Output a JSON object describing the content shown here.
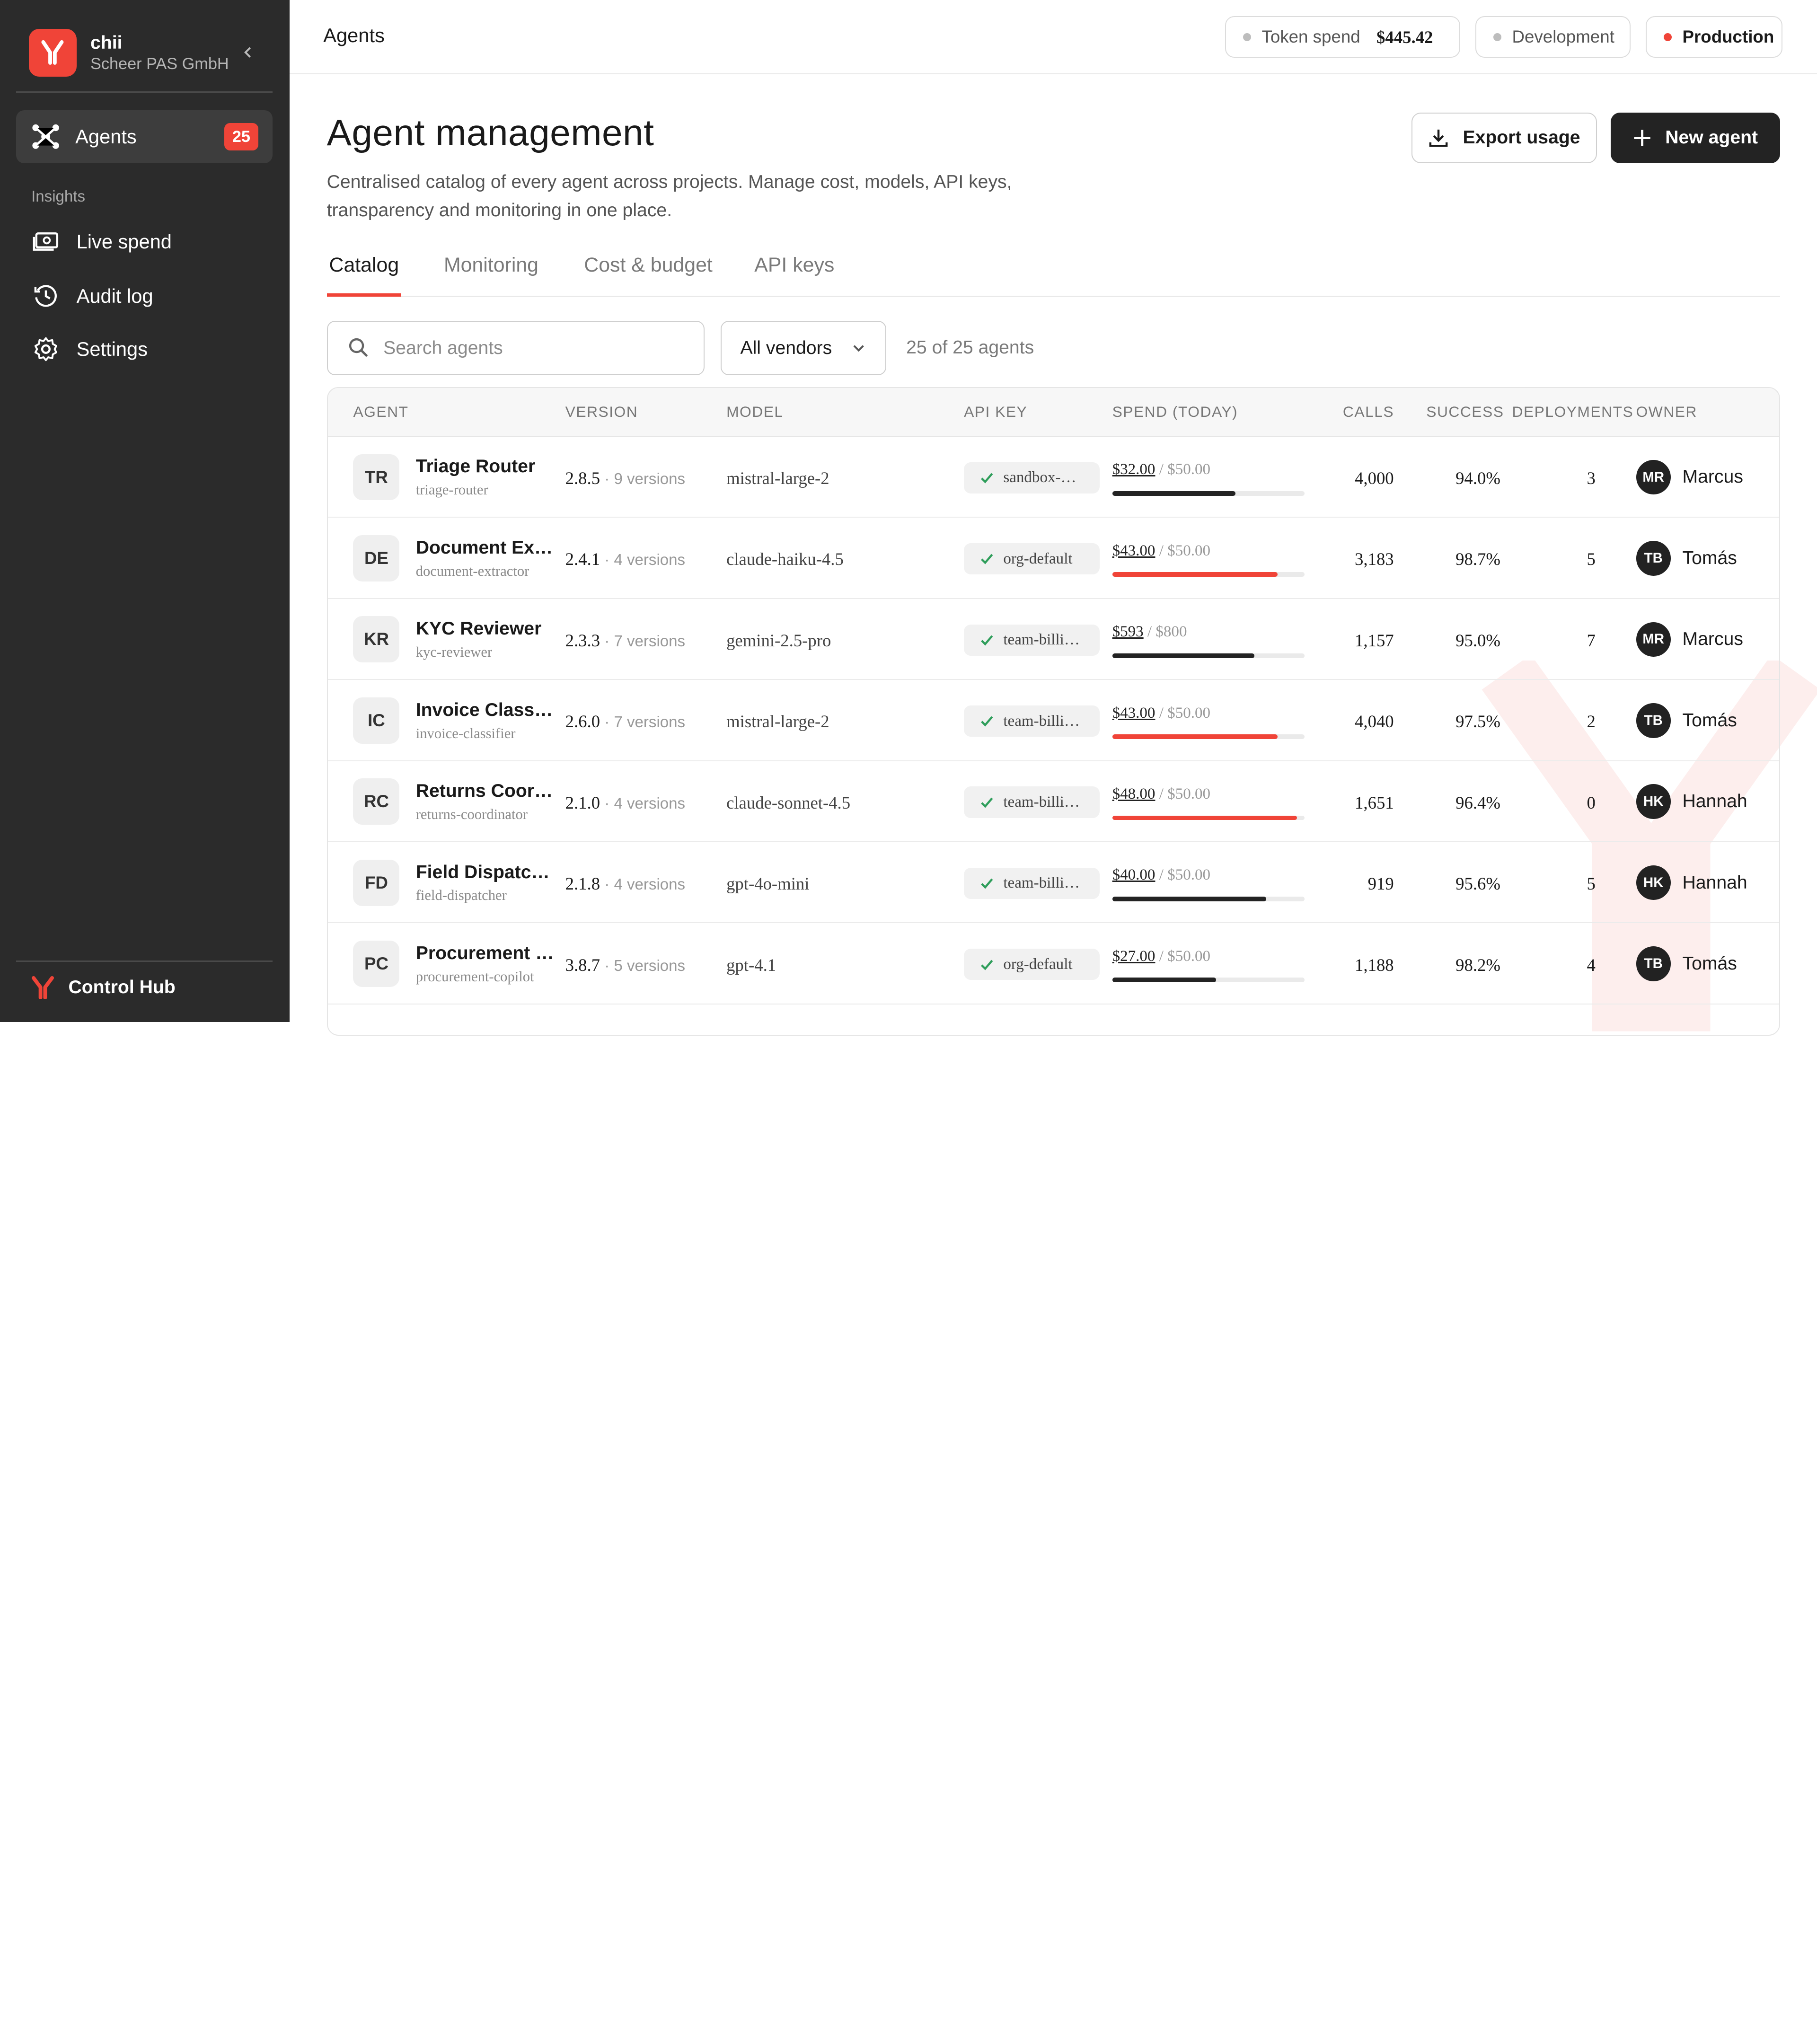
{
  "sidebar": {
    "org_name": "chii",
    "org_subtitle": "Scheer PAS GmbH",
    "agents_label": "Agents",
    "agents_badge": "25",
    "section_label": "Insights",
    "items": [
      {
        "label": "Live spend",
        "icon": "money-icon"
      },
      {
        "label": "Audit log",
        "icon": "history-icon"
      },
      {
        "label": "Settings",
        "icon": "gear-icon"
      }
    ],
    "footer_label": "Control Hub"
  },
  "topbar": {
    "breadcrumb": "Agents",
    "token_spend_label": "Token spend",
    "token_spend_value": "$445.42",
    "env_dev": "Development",
    "env_prod": "Production"
  },
  "colors": {
    "accent": "#f04438",
    "dark": "#232323",
    "sidebar": "#2b2b2b"
  },
  "main": {
    "title": "Agent management",
    "description": "Centralised catalog of every agent across projects. Manage cost, models, API keys, transparency and monitoring in one place.",
    "export_label": "Export usage",
    "new_label": "New agent",
    "tabs": [
      "Catalog",
      "Monitoring",
      "Cost & budget",
      "API keys"
    ],
    "search_placeholder": "Search agents",
    "vendor_filter": "All vendors",
    "count_text": "25 of 25 agents"
  },
  "table": {
    "columns": [
      "AGENT",
      "VERSION",
      "MODEL",
      "API KEY",
      "SPEND (TODAY)",
      "CALLS",
      "SUCCESS",
      "DEPLOYMENTS",
      "OWNER"
    ],
    "rows": [
      {
        "initials": "TR",
        "name": "Triage Router",
        "slug": "triage-router",
        "version": "2.8.5",
        "versions": "· 9 versions",
        "model": "mistral-large-2",
        "api_key": "sandbox-…",
        "spend": "$32.00",
        "budget": " / $50.00",
        "spend_fraction": 0.64,
        "over": false,
        "calls": "4,000",
        "success": "94.0%",
        "deployments": "3",
        "owner_initials": "MR",
        "owner": "Marcus"
      },
      {
        "initials": "DE",
        "name": "Document Ext…",
        "slug": "document-extractor",
        "version": "2.4.1",
        "versions": "· 4 versions",
        "model": "claude-haiku-4.5",
        "api_key": "org-default",
        "spend": "$43.00",
        "budget": " / $50.00",
        "spend_fraction": 0.86,
        "over": true,
        "calls": "3,183",
        "success": "98.7%",
        "deployments": "5",
        "owner_initials": "TB",
        "owner": "Tomás"
      },
      {
        "initials": "KR",
        "name": "KYC Reviewer",
        "slug": "kyc-reviewer",
        "version": "2.3.3",
        "versions": "· 7 versions",
        "model": "gemini-2.5-pro",
        "api_key": "team-billi…",
        "spend": "$593",
        "budget": " / $800",
        "spend_fraction": 0.74,
        "over": false,
        "calls": "1,157",
        "success": "95.0%",
        "deployments": "7",
        "owner_initials": "MR",
        "owner": "Marcus"
      },
      {
        "initials": "IC",
        "name": "Invoice Classi…",
        "slug": "invoice-classifier",
        "version": "2.6.0",
        "versions": "· 7 versions",
        "model": "mistral-large-2",
        "api_key": "team-billi…",
        "spend": "$43.00",
        "budget": " / $50.00",
        "spend_fraction": 0.86,
        "over": true,
        "calls": "4,040",
        "success": "97.5%",
        "deployments": "2",
        "owner_initials": "TB",
        "owner": "Tomás"
      },
      {
        "initials": "RC",
        "name": "Returns Coor…",
        "slug": "returns-coordinator",
        "version": "2.1.0",
        "versions": "· 4 versions",
        "model": "claude-sonnet-4.5",
        "api_key": "team-billi…",
        "spend": "$48.00",
        "budget": " / $50.00",
        "spend_fraction": 0.96,
        "over": true,
        "calls": "1,651",
        "success": "96.4%",
        "deployments": "0",
        "owner_initials": "HK",
        "owner": "Hannah"
      },
      {
        "initials": "FD",
        "name": "Field Dispatch…",
        "slug": "field-dispatcher",
        "version": "2.1.8",
        "versions": "· 4 versions",
        "model": "gpt-4o-mini",
        "api_key": "team-billi…",
        "spend": "$40.00",
        "budget": " / $50.00",
        "spend_fraction": 0.8,
        "over": false,
        "calls": "919",
        "success": "95.6%",
        "deployments": "5",
        "owner_initials": "HK",
        "owner": "Hannah"
      },
      {
        "initials": "PC",
        "name": "Procurement …",
        "slug": "procurement-copilot",
        "version": "3.8.7",
        "versions": "· 5 versions",
        "model": "gpt-4.1",
        "api_key": "org-default",
        "spend": "$27.00",
        "budget": " / $50.00",
        "spend_fraction": 0.54,
        "over": false,
        "calls": "1,188",
        "success": "98.2%",
        "deployments": "4",
        "owner_initials": "TB",
        "owner": "Tomás"
      }
    ]
  }
}
